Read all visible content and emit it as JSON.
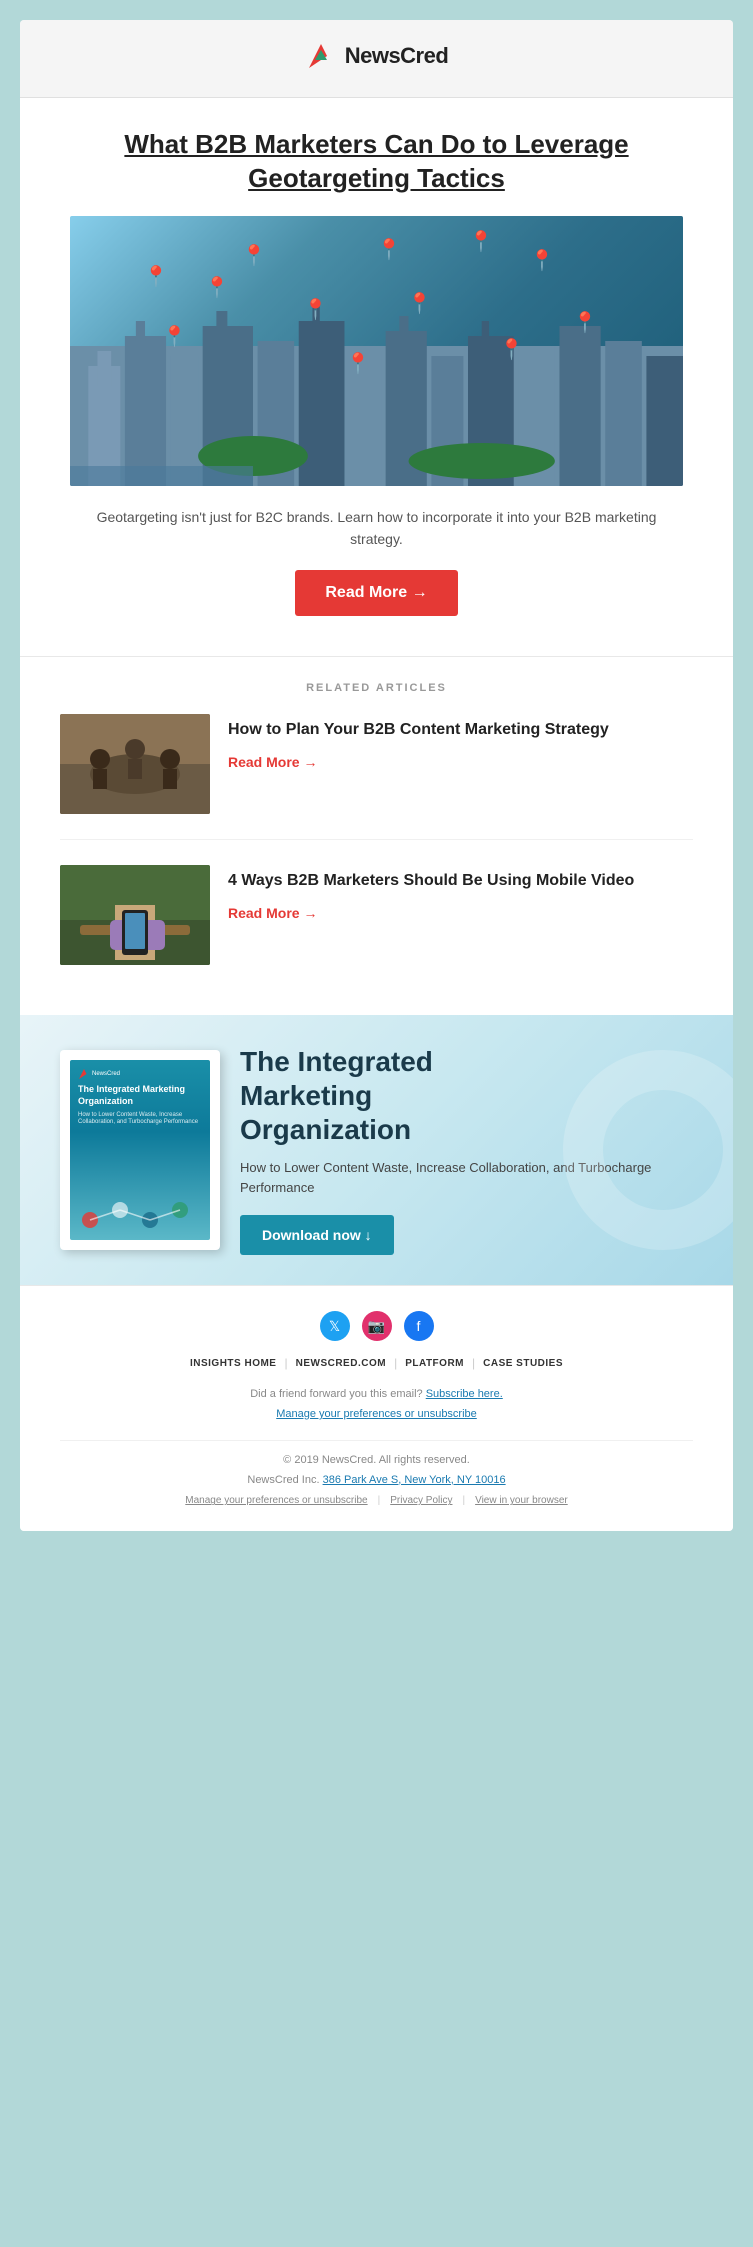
{
  "header": {
    "logo_text": "NewsCred"
  },
  "hero": {
    "title": "What B2B Marketers Can Do to Leverage Geotargeting Tactics",
    "description": "Geotargeting isn't just for B2C brands. Learn how to incorporate it into your B2B marketing strategy.",
    "read_more_btn": "Read More →"
  },
  "related": {
    "label": "RELATED ARTICLES",
    "articles": [
      {
        "title": "How to Plan Your B2B Content Marketing Strategy",
        "read_more": "Read More →"
      },
      {
        "title": "4 Ways B2B Marketers Should Be Using Mobile Video",
        "read_more": "Read More →"
      }
    ]
  },
  "cta": {
    "book_logo": "NewsCred",
    "book_title": "The Integrated Marketing Organization",
    "book_subtitle": "How to Lower Content Waste, Increase Collaboration, and Turbocharge Performance",
    "main_title_line1": "The Integrated",
    "main_title_line2": "Marketing",
    "main_title_line3": "Organization",
    "subtitle": "How to Lower Content Waste, Increase Collaboration, and Turbocharge Performance",
    "download_btn": "Download now ↓"
  },
  "footer": {
    "nav_items": [
      "INSIGHTS HOME",
      "NEWSCRED.COM",
      "PLATFORM",
      "CASE STUDIES"
    ],
    "forward_text": "Did a friend forward you this email?",
    "subscribe_link": "Subscribe here.",
    "manage_link": "Manage your preferences or unsubscribe",
    "copyright": "© 2019 NewsCred. All rights reserved.",
    "address_pre": "NewsCred Inc.",
    "address_link": "386 Park Ave S, New York, NY 10016",
    "bottom_links": [
      "Manage your preferences or unsubscribe",
      "Privacy Policy",
      "View in your browser"
    ]
  }
}
